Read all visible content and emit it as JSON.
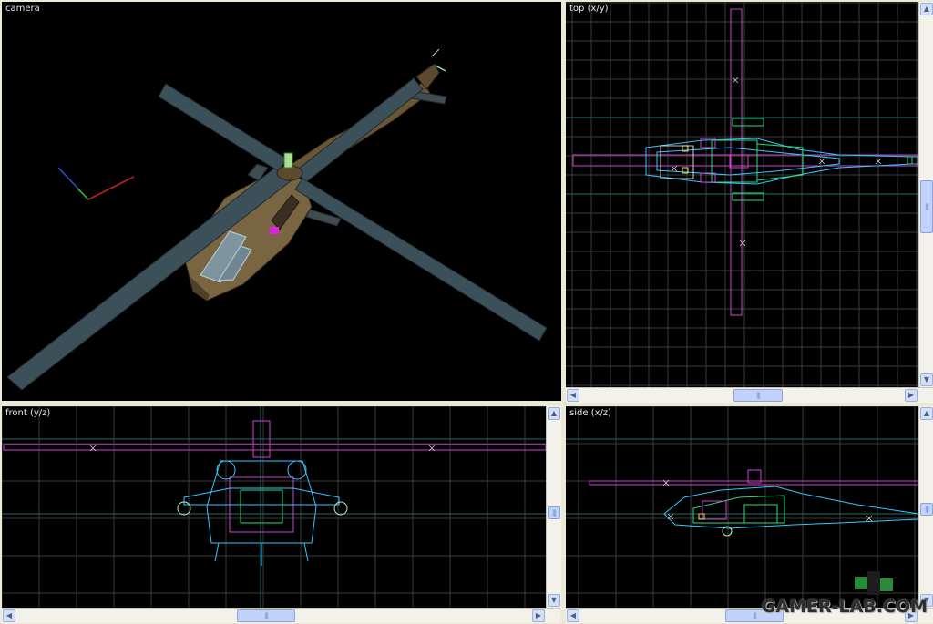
{
  "viewports": {
    "camera": {
      "label": "camera"
    },
    "top": {
      "label": "top (x/y)"
    },
    "front": {
      "label": "front (y/z)"
    },
    "side": {
      "label": "side (x/z)"
    }
  },
  "scroll_glyphs": {
    "up": "▲",
    "down": "▼",
    "left": "◀",
    "right": "▶",
    "grip": "|||"
  },
  "watermark": {
    "text": "GAMER-LAB.COM"
  },
  "colors": {
    "grid": "#3a3a3a",
    "axis": "#1f6d6d",
    "magenta": "#d040d0",
    "cyan": "#34c6ff",
    "green": "#22e07a",
    "yellow": "#e8e04a",
    "white": "#ffffff",
    "rotor": "#3c5059",
    "body": "#6e5a3c"
  }
}
